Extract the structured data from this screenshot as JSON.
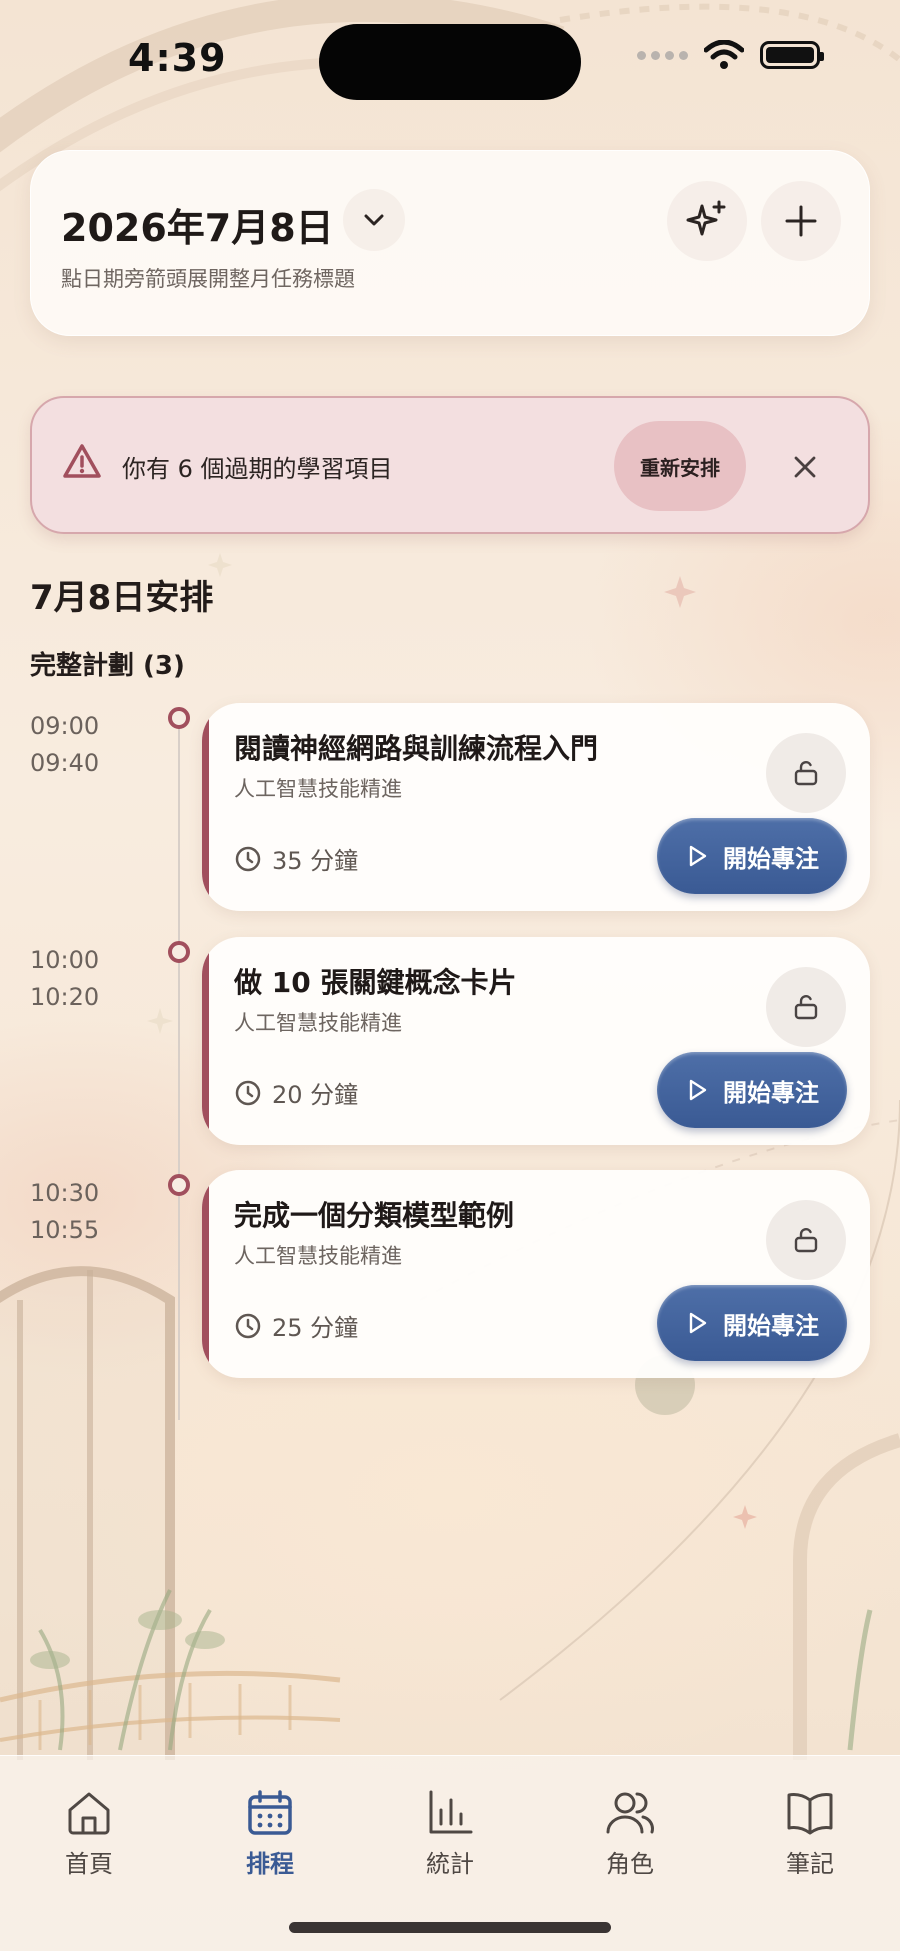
{
  "status_bar": {
    "time": "4:39"
  },
  "header": {
    "date": "2026年7月8日",
    "hint": "點日期旁箭頭展開整月任務標題"
  },
  "alert": {
    "message": "你有 6 個過期的學習項目",
    "action_label": "重新安排"
  },
  "schedule": {
    "section_title": "7月8日安排",
    "plan_title": "完整計劃 (3)",
    "tasks": [
      {
        "start": "09:00",
        "end": "09:40",
        "title": "閱讀神經網路與訓練流程入門",
        "subtitle": "人工智慧技能精進",
        "duration": "35 分鐘",
        "action": "開始專注"
      },
      {
        "start": "10:00",
        "end": "10:20",
        "title": "做 10 張關鍵概念卡片",
        "subtitle": "人工智慧技能精進",
        "duration": "20 分鐘",
        "action": "開始專注"
      },
      {
        "start": "10:30",
        "end": "10:55",
        "title": "完成一個分類模型範例",
        "subtitle": "人工智慧技能精進",
        "duration": "25 分鐘",
        "action": "開始專注"
      }
    ]
  },
  "nav": {
    "items": [
      {
        "label": "首頁",
        "icon": "home-icon"
      },
      {
        "label": "排程",
        "icon": "calendar-icon",
        "active": true
      },
      {
        "label": "統計",
        "icon": "bar-chart-icon"
      },
      {
        "label": "角色",
        "icon": "users-icon"
      },
      {
        "label": "筆記",
        "icon": "book-icon"
      }
    ]
  },
  "colors": {
    "accent": "#3a5a94",
    "timeline": "#a14f5d",
    "alert_bg": "#f3dfe0",
    "alert_button": "#e8c1c4"
  }
}
